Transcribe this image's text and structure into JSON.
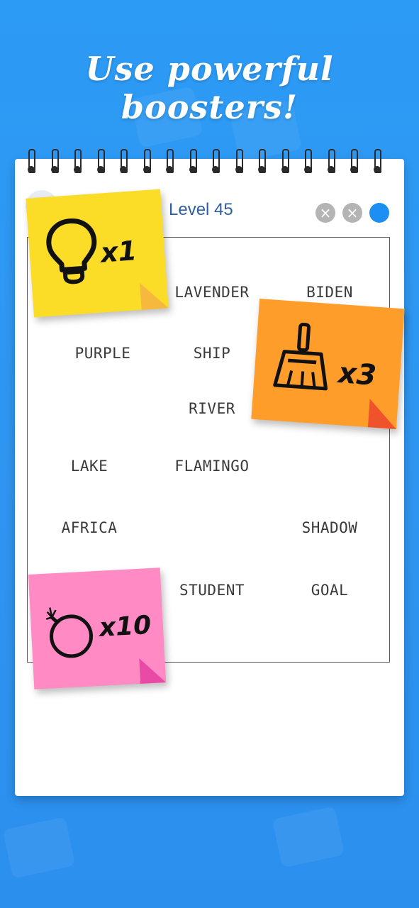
{
  "promo": {
    "headline": "Use powerful boosters!"
  },
  "game": {
    "level_title": "Level 45",
    "controls": [
      {
        "name": "close-icon",
        "glyph": "×"
      },
      {
        "name": "close-icon",
        "glyph": "×"
      },
      {
        "name": "status-dot-icon",
        "glyph": ""
      }
    ],
    "words": [
      {
        "text": "LAVENDER"
      },
      {
        "text": "BIDEN"
      },
      {
        "text": "PURPLE"
      },
      {
        "text": "SHIP"
      },
      {
        "text": "RIVER"
      },
      {
        "text": "LAKE"
      },
      {
        "text": "FLAMINGO"
      },
      {
        "text": "AFRICA"
      },
      {
        "text": "SHADOW"
      },
      {
        "text": "STUDENT"
      },
      {
        "text": "GOAL"
      }
    ]
  },
  "boosters": {
    "hint": {
      "icon": "lightbulb-icon",
      "count": "x1",
      "color": "#fbdc26"
    },
    "broom": {
      "icon": "broom-icon",
      "count": "x3",
      "color": "#ff9d2a"
    },
    "bomb": {
      "icon": "bomb-icon",
      "count": "x10",
      "color": "#ff8ac4"
    }
  },
  "colors": {
    "background": "#2c9bf5",
    "level_text": "#2f5fa0",
    "accent_blue": "#1e8ff2"
  }
}
